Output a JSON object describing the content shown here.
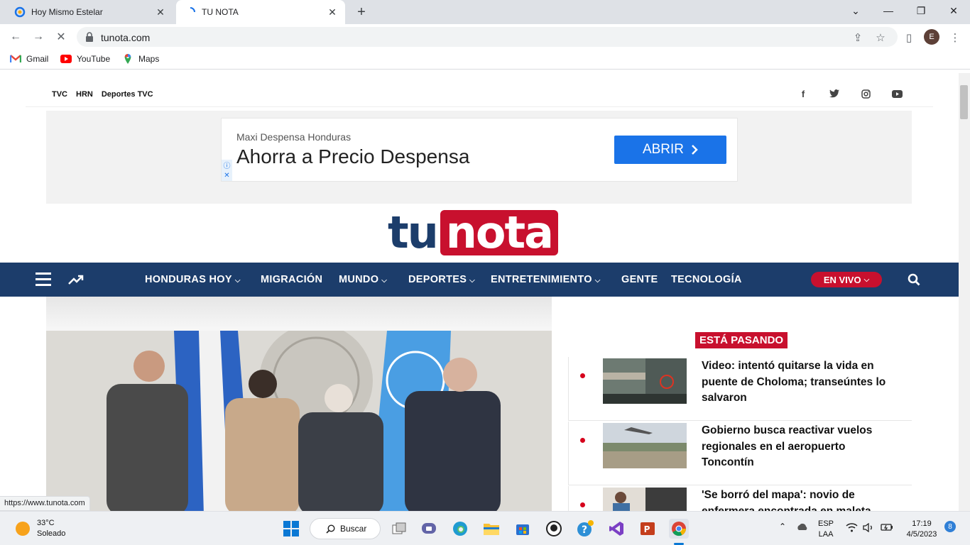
{
  "browser": {
    "tabs": [
      {
        "title": "Hoy Mismo Estelar",
        "active": false
      },
      {
        "title": "TU NOTA",
        "active": true
      }
    ],
    "url": "tunota.com",
    "profile_initial": "E",
    "bookmarks": [
      {
        "label": "Gmail",
        "icon": "gmail-icon"
      },
      {
        "label": "YouTube",
        "icon": "youtube-icon"
      },
      {
        "label": "Maps",
        "icon": "maps-icon"
      }
    ],
    "status_url": "https://www.tunota.com"
  },
  "site": {
    "top_links": [
      "TVC",
      "HRN",
      "Deportes TVC"
    ],
    "social": [
      "facebook-icon",
      "twitter-icon",
      "instagram-icon",
      "youtube-icon"
    ],
    "ad": {
      "advertiser": "Maxi Despensa Honduras",
      "headline": "Ahorra a Precio Despensa",
      "cta": "ABRIR"
    },
    "logo": {
      "part1": "tu",
      "part2": "nota"
    },
    "nav": [
      {
        "label": "HONDURAS HOY",
        "dropdown": true
      },
      {
        "label": "MIGRACIÓN",
        "dropdown": false
      },
      {
        "label": "MUNDO",
        "dropdown": true
      },
      {
        "label": "DEPORTES",
        "dropdown": true
      },
      {
        "label": "ENTRETENIMIENTO",
        "dropdown": true
      },
      {
        "label": "GENTE",
        "dropdown": false
      },
      {
        "label": "TECNOLOGÍA",
        "dropdown": false
      }
    ],
    "live_label": "EN VIVO",
    "sidebar": {
      "label": "ESTÁ PASANDO",
      "items": [
        {
          "title": "Video: intentó quitarse la vida en puente de Choloma; transeúntes lo salvaron"
        },
        {
          "title": "Gobierno busca reactivar vuelos regionales en el aeropuerto Toncontín"
        },
        {
          "title": "'Se borró del mapa': novio de enfermera encontrada en maleta"
        }
      ]
    }
  },
  "taskbar": {
    "weather_temp": "33°C",
    "weather_desc": "Soleado",
    "search_label": "Buscar",
    "lang1": "ESP",
    "lang2": "LAA",
    "time": "17:19",
    "date": "4/5/2023",
    "notifications": "8"
  }
}
